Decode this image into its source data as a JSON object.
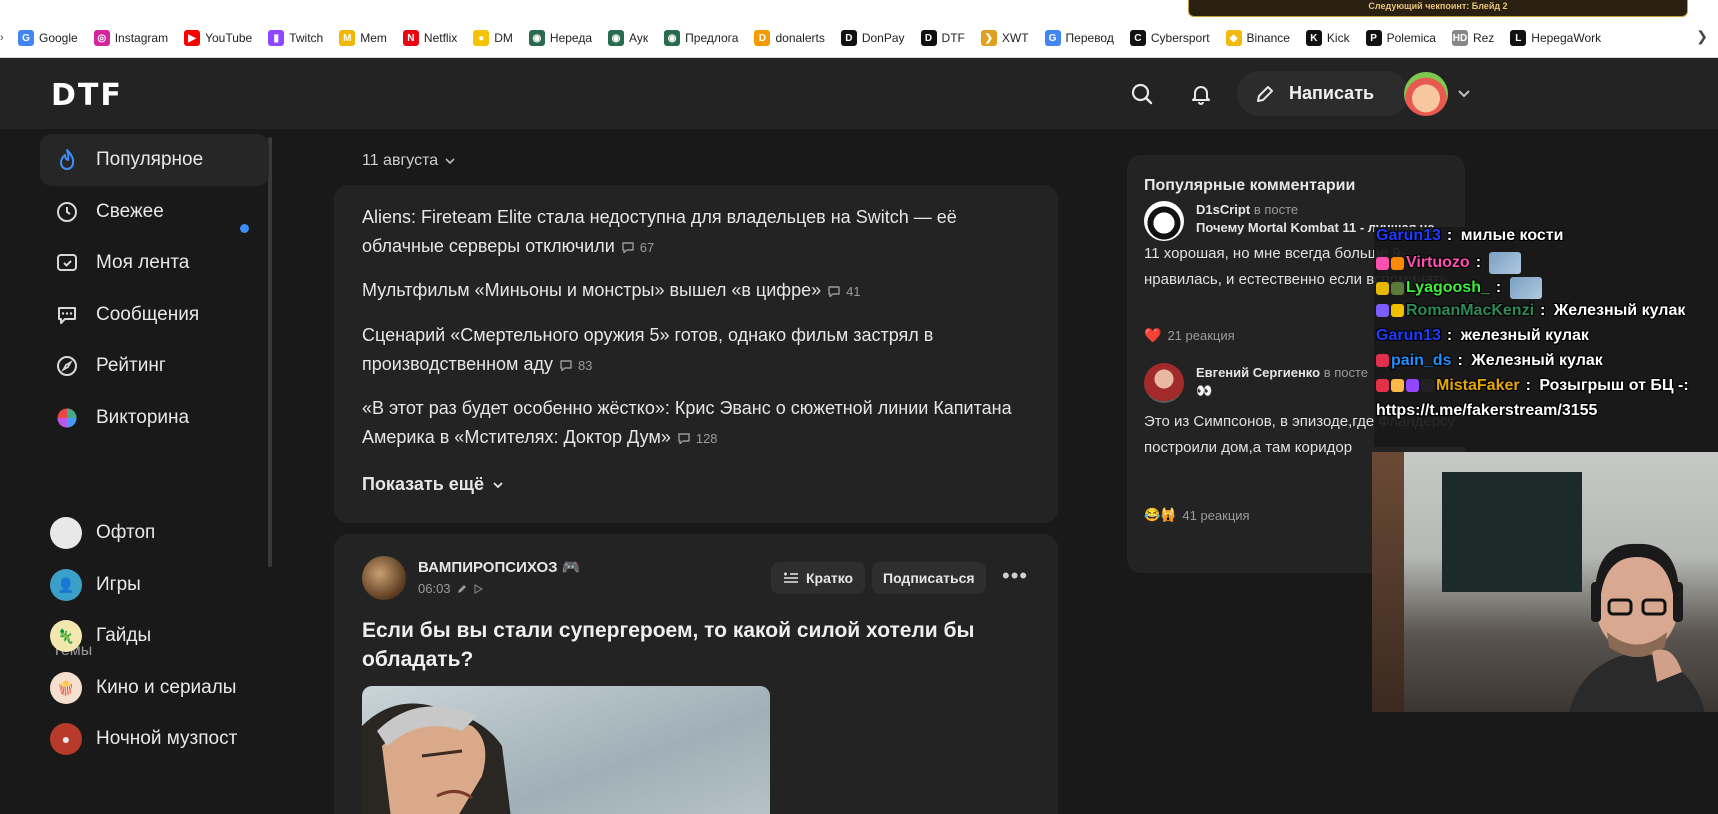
{
  "browser": {
    "banner_text": "Следующий чекпоинт: Блейд 2",
    "bookmarks": [
      {
        "label": "Google",
        "icon": "google-icon",
        "color": "#4285f4",
        "glyph": "G"
      },
      {
        "label": "Instagram",
        "icon": "instagram-icon",
        "color": "#d6249f",
        "glyph": "◎"
      },
      {
        "label": "YouTube",
        "icon": "youtube-icon",
        "color": "#ff0000",
        "glyph": "▶"
      },
      {
        "label": "Twitch",
        "icon": "twitch-icon",
        "color": "#9146ff",
        "glyph": "▮"
      },
      {
        "label": "Mem",
        "icon": "mem-icon",
        "color": "#f2b705",
        "glyph": "M"
      },
      {
        "label": "Netflix",
        "icon": "netflix-icon",
        "color": "#e50914",
        "glyph": "N"
      },
      {
        "label": "DM",
        "icon": "dm-icon",
        "color": "#f5c400",
        "glyph": "●"
      },
      {
        "label": "Нереда",
        "icon": "nereda-icon",
        "color": "#2a6b4f",
        "glyph": "◉"
      },
      {
        "label": "Аук",
        "icon": "auk-icon",
        "color": "#2a6b4f",
        "glyph": "◉"
      },
      {
        "label": "Предлога",
        "icon": "predloga-icon",
        "color": "#2a6b4f",
        "glyph": "◉"
      },
      {
        "label": "donalerts",
        "icon": "donalerts-icon",
        "color": "#f59b00",
        "glyph": "D"
      },
      {
        "label": "DonPay",
        "icon": "donpay-icon",
        "color": "#111111",
        "glyph": "D"
      },
      {
        "label": "DTF",
        "icon": "dtf-icon",
        "color": "#111111",
        "glyph": "D"
      },
      {
        "label": "XWT",
        "icon": "xwt-icon",
        "color": "#e0a020",
        "glyph": "❯"
      },
      {
        "label": "Перевод",
        "icon": "translate-icon",
        "color": "#4285f4",
        "glyph": "G"
      },
      {
        "label": "Cybersport",
        "icon": "cybersport-icon",
        "color": "#111111",
        "glyph": "C"
      },
      {
        "label": "Binance",
        "icon": "binance-icon",
        "color": "#f0b90b",
        "glyph": "◆"
      },
      {
        "label": "Kick",
        "icon": "kick-icon",
        "color": "#111111",
        "glyph": "K"
      },
      {
        "label": "Polemica",
        "icon": "polemica-icon",
        "color": "#111111",
        "glyph": "P"
      },
      {
        "label": "Rez",
        "icon": "rez-icon",
        "color": "#888888",
        "glyph": "HD"
      },
      {
        "label": "HepegaWork",
        "icon": "hepegawork-icon",
        "color": "#111111",
        "glyph": "L"
      }
    ],
    "more_glyph": "❯"
  },
  "header": {
    "logo": "DTF",
    "write_label": "Написать"
  },
  "sidebar": {
    "nav": [
      {
        "label": "Популярное",
        "icon": "fire-icon"
      },
      {
        "label": "Свежее",
        "icon": "clock-icon"
      },
      {
        "label": "Моя лента",
        "icon": "feed-icon"
      },
      {
        "label": "Сообщения",
        "icon": "messages-icon"
      },
      {
        "label": "Рейтинг",
        "icon": "compass-icon"
      },
      {
        "label": "Викторина",
        "icon": "quiz-icon"
      }
    ],
    "themes_title": "Темы",
    "topics": [
      {
        "label": "Офтоп",
        "color": "#e8e8e8",
        "glyph": "🌪"
      },
      {
        "label": "Игры",
        "color": "#3aa0c8",
        "glyph": "👤"
      },
      {
        "label": "Гайды",
        "color": "#f3e7b0",
        "glyph": "🦎"
      },
      {
        "label": "Кино и сериалы",
        "color": "#f5e0d0",
        "glyph": "🍿"
      },
      {
        "label": "Ночной музпост",
        "color": "#b83a2a",
        "glyph": "●"
      }
    ]
  },
  "feed": {
    "date_label": "11 августа",
    "news": [
      {
        "title": "Aliens: Fireteam Elite стала недоступна для владельцев на Switch — её облачные серверы отключили",
        "comments": "67"
      },
      {
        "title": "Мультфильм «Миньоны и монстры» вышел «в цифре»",
        "comments": "41"
      },
      {
        "title": "Сценарий «Смертельного оружия 5» готов, однако фильм застрял в производственном аду",
        "comments": "83"
      },
      {
        "title": "«В этот раз будет особенно жёстко»: Крис Эванс о сюжетной линии Капитана Америка в «Мстителях: Доктор Дум»",
        "comments": "128"
      }
    ],
    "show_more": "Показать ещё",
    "post": {
      "author": "ВАМПИРОПСИХОЗ 🎮",
      "time": "06:03",
      "brief_label": "Кратко",
      "subscribe_label": "Подписаться",
      "more_glyph": "•••",
      "title": "Если бы вы стали супергероем, то какой силой хотели бы обладать?"
    }
  },
  "popular_comments": {
    "title": "Популярные комментарии",
    "items": [
      {
        "author": "D1sCript",
        "in_post": "в посте",
        "post": "Почему Mortal Kombat 11 - лучшая ча",
        "text": "11 хорошая, но мне всегда больше 9 нравилась, и естественно если вспоминать",
        "reactions": "21 реакция",
        "reaction_emoji": "❤️"
      },
      {
        "author": "Евгений Сергиенко",
        "in_post": "в посте",
        "post": "👀",
        "text": "Это из Симпсонов, в эпизоде,где Фландерсу построили дом,а там коридор",
        "reactions": "41 реакция",
        "reaction_emoji": "😂🙀"
      }
    ]
  },
  "stream_chat": [
    {
      "user": "Garun13",
      "user_color": "#1e3cff",
      "message": "милые кости"
    },
    {
      "user": "Virtuozo",
      "user_color": "#ff4fb0",
      "message": ""
    },
    {
      "user": "Lyagoosh_",
      "user_color": "#3cf03c",
      "message": ""
    },
    {
      "user": "RomanMacKenzi",
      "user_color": "#2e8b57",
      "message": "Железный кулак"
    },
    {
      "user": "Garun13",
      "user_color": "#1e3cff",
      "message": "железный кулак"
    },
    {
      "user": "pain_ds",
      "user_color": "#1e90ff",
      "message": "Железный кулак"
    },
    {
      "user": "MistaFaker",
      "user_color": "#e6a800",
      "message": "Розыгрыш от БЦ -:"
    },
    {
      "user": "",
      "user_color": "#ffffff",
      "message": "https://t.me/fakerstream/3155"
    }
  ]
}
